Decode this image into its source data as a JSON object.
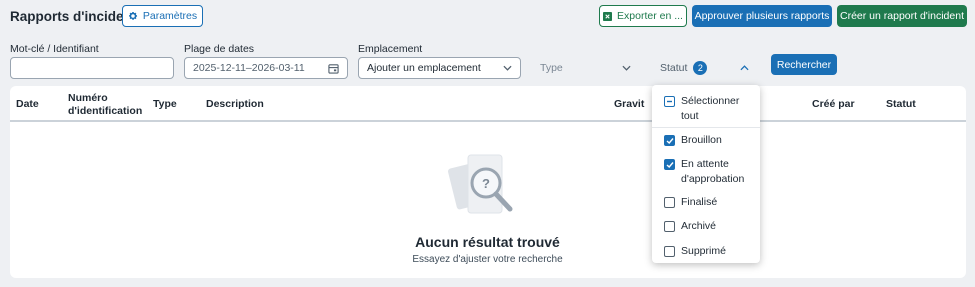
{
  "header": {
    "title": "Rapports d'incident",
    "params_label": "Paramètres",
    "export_label": "Exporter en ...",
    "approve_label": "Approuver plusieurs rapports",
    "create_label": "Créer un rapport d'incident"
  },
  "filters": {
    "keyword_label": "Mot-clé / Identifiant",
    "keyword_value": "",
    "date_label": "Plage de dates",
    "date_value": "2025-12-11–2026-03-11",
    "location_label": "Emplacement",
    "location_value": "Ajouter un emplacement",
    "type_label": "Type",
    "status_label": "Statut",
    "status_count": "2",
    "search_label": "Rechercher"
  },
  "table": {
    "columns": [
      "Date",
      "Numéro d'identification",
      "Type",
      "Description",
      "Gravité",
      "Créé par",
      "Statut"
    ],
    "col_date": "Date",
    "col_id_line1": "Numéro",
    "col_id_line2": "d'identification",
    "col_type": "Type",
    "col_description": "Description",
    "col_severity": "Gravit",
    "col_created_by": "Créé par",
    "col_status": "Statut"
  },
  "empty": {
    "title": "Aucun résultat trouvé",
    "subtitle": "Essayez d'ajuster votre recherche"
  },
  "status_dropdown": {
    "select_all": [
      "Sélectionner",
      "tout"
    ],
    "select_all_state": "indeterminate",
    "options": [
      {
        "lines": [
          "Brouillon"
        ],
        "checked": true
      },
      {
        "lines": [
          "En attente",
          "d'approbation"
        ],
        "checked": true
      },
      {
        "lines": [
          "Finalisé"
        ],
        "checked": false
      },
      {
        "lines": [
          "Archivé"
        ],
        "checked": false
      },
      {
        "lines": [
          "Supprimé"
        ],
        "checked": false
      }
    ]
  },
  "colors": {
    "primary": "#1a6fb5",
    "success": "#1f7a4d",
    "background": "#eef0f3"
  }
}
